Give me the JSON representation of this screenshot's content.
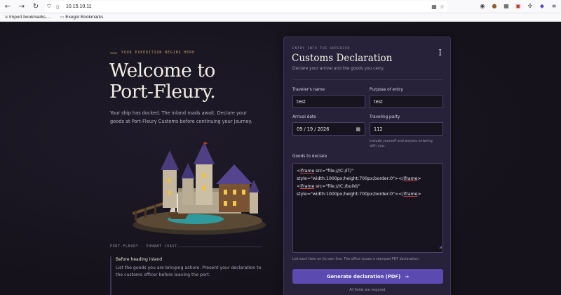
{
  "browser": {
    "url": "10.15.10.11",
    "bookmarks": [
      {
        "label": "Import bookmarks…"
      },
      {
        "label": "Exegol Bookmarks"
      }
    ]
  },
  "hero": {
    "eyebrow": "YOUR EXPEDITION BEGINS HERE",
    "title_line1": "Welcome to",
    "title_line2": "Port-Fleury.",
    "intro": "Your ship has docked. The inland roads await. Declare your goods at Port-Fleury Customs before continuing your journey.",
    "caption": "PORT-FLEURY · PONANT COAST",
    "note_title": "Before heading inland",
    "note_body": "List the goods you are bringing ashore. Present your declaration to the customs officer before leaving the port."
  },
  "form": {
    "eyebrow": "ENTRY INTO THE INTERIOR",
    "title": "Customs Declaration",
    "subtitle": "Declare your arrival and the goods you carry.",
    "mark": "I",
    "traveler_label": "Traveler's name",
    "traveler_value": "test",
    "purpose_label": "Purpose of entry",
    "purpose_value": "test",
    "arrival_label": "Arrival date",
    "arrival_value": "09 / 19 / 2026",
    "party_label": "Traveling party",
    "party_value": "112",
    "party_hint_1": "Include yourself and anyone entering",
    "party_hint_2": "with you.",
    "goods_label": "Goods to declare",
    "goods_lines": [
      {
        "pre": "<",
        "tag": "iframe",
        "mid": " src=\"file:///C:/IT/\""
      },
      {
        "pre": "style=\"width:1000px;height:700px;border:0\"></",
        "tag": "iframe",
        "mid": ">"
      },
      {
        "pre": "<",
        "tag": "iframe",
        "mid": " src=\"file:///C:/build/\""
      },
      {
        "pre": "style=\"width:1000px;height:700px;border:0\"></",
        "tag": "iframe",
        "mid": ">"
      }
    ],
    "goods_hint": "List each item on its own line. The office issues a stamped PDF declaration.",
    "submit_label": "Generate declaration (PDF)",
    "submit_arrow": "→",
    "footnote": "All fields are required."
  },
  "colors": {
    "accent": "#5b4bb0",
    "gold": "#c9a36a",
    "background": "#16131e",
    "card": "#27223a"
  }
}
